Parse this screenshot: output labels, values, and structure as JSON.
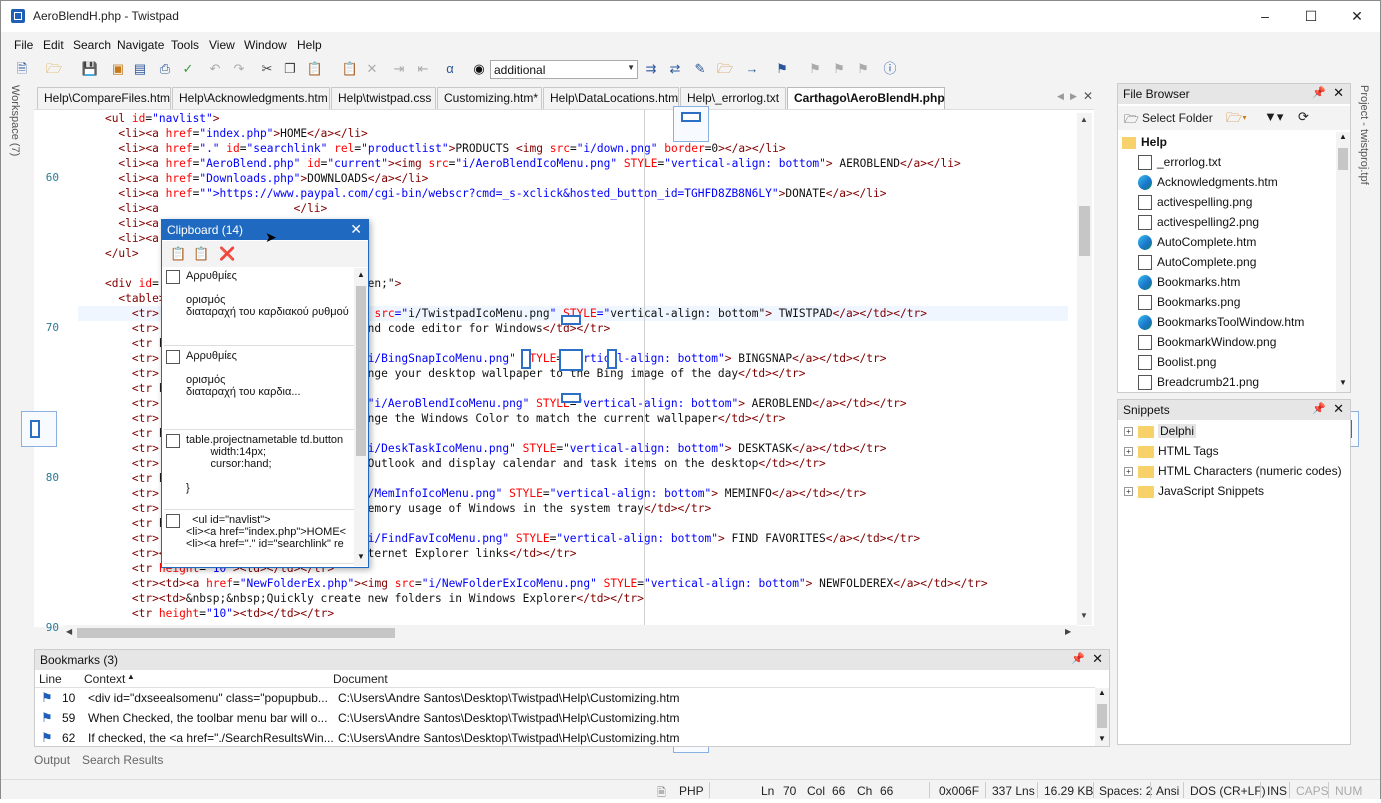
{
  "window": {
    "title": "AeroBlendH.php - Twistpad"
  },
  "menu": [
    "File",
    "Edit",
    "Search",
    "Navigate",
    "Tools",
    "View",
    "Window",
    "Help"
  ],
  "toolbar": {
    "combo_value": "additional"
  },
  "sidebar_left_label": "Workspace (7)",
  "sidebar_right_label": "Project - twistproj.tpf",
  "tabs": [
    "Help\\CompareFiles.htm",
    "Help\\Acknowledgments.htm",
    "Help\\twistpad.css",
    "Customizing.htm*",
    "Help\\DataLocations.htm",
    "Help\\_errorlog.txt",
    "Carthago\\AeroBlendH.php"
  ],
  "editor": {
    "line_numbers": [
      {
        "n": "60",
        "row": 3
      },
      {
        "n": "70",
        "row": 13
      },
      {
        "n": "80",
        "row": 23
      },
      {
        "n": "90",
        "row": 33
      }
    ],
    "lines": [
      "    <ul id=\"navlist\">",
      "      <li><a href=\"index.php\">HOME</a></li>",
      "      <li><a href=\".\" id=\"searchlink\" rel=\"productlist\">PRODUCTS <img src=\"i/down.png\" border=0></a></li>",
      "      <li><a href=\"AeroBlend.php\" id=\"current\"><img src=\"i/AeroBlendIcoMenu.png\" STYLE=\"vertical-align: bottom\"> AEROBLEND</a></li>",
      "      <li><a href=\"Downloads.php\">DOWNLOADS</a></li>",
      "      <li><a href=\"https://www.paypal.com/cgi-bin/webscr?cmd=_s-xclick&hosted_button_id=TGHFD8ZB8N6LY\">DONATE</a></li>",
      "      <li><a                    </li>",
      "      <li><a",
      "      <li><a                         </li>",
      "    </ul>",
      "",
      "    <div id=                         : hidden;\">",
      "      <table>",
      "        <tr>                         \"><img src=\"i/TwistpadIcoMenu.png\" STYLE=\"vertical-align: bottom\"> TWISTPAD</a></td></tr>",
      "        <tr>                         text and code editor for Windows</td></tr>",
      "        <tr h",
      "        <tr>                          src=\"i/BingSnapIcoMenu.png\" STYLE=\"vertical-align: bottom\"> BINGSNAP</a></td></tr>",
      "        <tr>                         ly change your desktop wallpaper to the Bing image of the day</td></tr>",
      "        <tr h",
      "        <tr>                         g src=\"i/AeroBlendIcoMenu.png\" STYLE=\"vertical-align: bottom\"> AEROBLEND</a></td></tr>",
      "        <tr>                         ly change the Windows Color to match the current wallpaper</td></tr>",
      "        <tr h",
      "        <tr>                          src=\"i/DeskTaskIcoMenu.png\" STYLE=\"vertical-align: bottom\"> DESKTASK</a></td></tr>",
      "        <tr>                         osoft Outlook and display calendar and task items on the desktop</td></tr>",
      "        <tr h",
      "        <tr>                         src=\"i/MemInfoIcoMenu.png\" STYLE=\"vertical-align: bottom\"> MEMINFO</a></td></tr>",
      "        <tr>                         rent memory usage of Windows in the system tray</td></tr>",
      "        <tr h",
      "        <tr>                          src=\"i/FindFavIcoMenu.png\" STYLE=\"vertical-align: bottom\"> FIND FAVORITES</a></td></tr>",
      "        <tr><td>&nbsp;&nbsp;Quickly find Internet Explorer links</td></tr>",
      "        <tr height=\"10\"><td></td></tr>",
      "        <tr><td><a href=\"NewFolderEx.php\"><img src=\"i/NewFolderExIcoMenu.png\" STYLE=\"vertical-align: bottom\"> NEWFOLDEREX</a></td></tr>",
      "        <tr><td>&nbsp;&nbsp;Quickly create new folders in Windows Explorer</td></tr>",
      "        <tr height=\"10\"><td></td></tr>"
    ]
  },
  "clipboard": {
    "title": "Clipboard (14)",
    "items": [
      "Αρρυθμίες\n\nορισμός\nδιαταραχή του καρδιακού ρυθμού",
      "Αρρυθμίες\n\nορισμός\nδιαταραχή του καρδια...",
      "table.projectnametable td.button\n        width:14px;\n        cursor:hand;\n\n}",
      "  <ul id=\"navlist\">\n<li><a href=\"index.php\">HOME<\n<li><a href=\".\" id=\"searchlink\" re"
    ]
  },
  "file_browser": {
    "title": "File Browser",
    "select_folder": "Select Folder",
    "folder": "Help",
    "files": [
      {
        "name": "_errorlog.txt",
        "type": "doc"
      },
      {
        "name": "Acknowledgments.htm",
        "type": "edge"
      },
      {
        "name": "activespelling.png",
        "type": "doc"
      },
      {
        "name": "activespelling2.png",
        "type": "doc"
      },
      {
        "name": "AutoComplete.htm",
        "type": "edge"
      },
      {
        "name": "AutoComplete.png",
        "type": "doc"
      },
      {
        "name": "Bookmarks.htm",
        "type": "edge"
      },
      {
        "name": "Bookmarks.png",
        "type": "doc"
      },
      {
        "name": "BookmarksToolWindow.htm",
        "type": "edge"
      },
      {
        "name": "BookmarkWindow.png",
        "type": "doc"
      },
      {
        "name": "Boolist.png",
        "type": "doc"
      },
      {
        "name": "Breadcrumb21.png",
        "type": "doc"
      }
    ]
  },
  "snippets": {
    "title": "Snippets",
    "items": [
      "Delphi",
      "HTML Tags",
      "HTML Characters (numeric codes)",
      "JavaScript Snippets"
    ]
  },
  "bookmarks": {
    "title": "Bookmarks (3)",
    "columns": [
      "Line",
      "Context",
      "Document"
    ],
    "rows": [
      {
        "line": "10",
        "context": "<div id=\"dxseealsomenu\" class=\"popupbub...",
        "document": "C:\\Users\\Andre Santos\\Desktop\\Twistpad\\Help\\Customizing.htm"
      },
      {
        "line": "59",
        "context": "When Checked, the toolbar menu bar will o...",
        "document": "C:\\Users\\Andre Santos\\Desktop\\Twistpad\\Help\\Customizing.htm"
      },
      {
        "line": "62",
        "context": "If checked, the <a href=\"./SearchResultsWin...",
        "document": "C:\\Users\\Andre Santos\\Desktop\\Twistpad\\Help\\Customizing.htm"
      }
    ]
  },
  "bottom_tabs": [
    "Output",
    "Search Results"
  ],
  "status": {
    "lang": "PHP",
    "ln_label": "Ln",
    "ln": "70",
    "col_label": "Col",
    "col": "66",
    "ch_label": "Ch",
    "ch": "66",
    "code": "0x006F",
    "lines": "337 Lns",
    "size": "16.29 KB",
    "spaces": "Spaces: 2",
    "encoding": "Ansi",
    "eol": "DOS (CR+LF)",
    "ins": "INS",
    "caps": "CAPS",
    "num": "NUM"
  }
}
